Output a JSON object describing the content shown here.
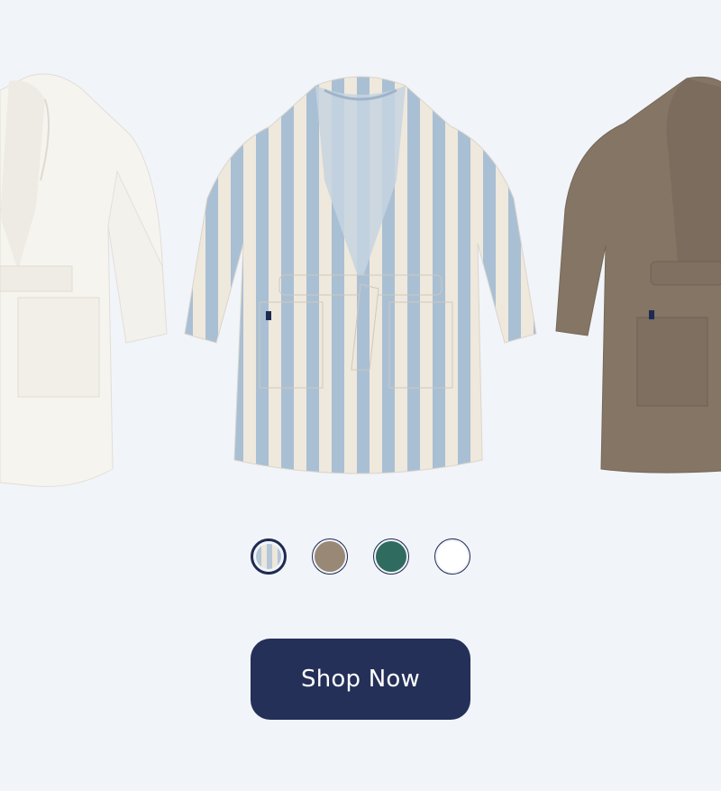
{
  "products": [
    {
      "name": "white-robe",
      "color": "#f6f4ef"
    },
    {
      "name": "striped-robe",
      "color": "#a9bfd4",
      "stripe": "#efe8dc"
    },
    {
      "name": "taupe-robe",
      "color": "#857565"
    }
  ],
  "swatches": [
    {
      "name": "striped",
      "colors": [
        "#b5c6d7",
        "#ece6dc"
      ],
      "selected": true
    },
    {
      "name": "taupe",
      "colors": [
        "#9a8876"
      ],
      "selected": false
    },
    {
      "name": "green",
      "colors": [
        "#2f6b5e"
      ],
      "selected": false
    },
    {
      "name": "white",
      "colors": [
        "#ffffff"
      ],
      "selected": false
    }
  ],
  "cta": {
    "label": "Shop Now",
    "background": "#243058"
  }
}
